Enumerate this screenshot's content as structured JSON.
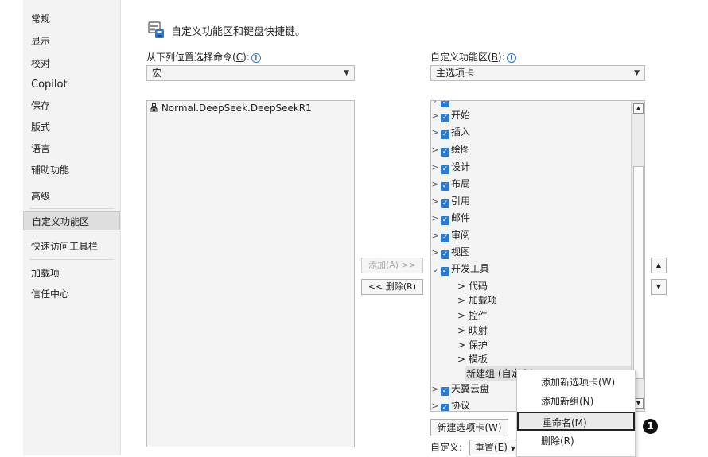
{
  "sidebar": {
    "items": [
      {
        "label": "常规"
      },
      {
        "label": "显示"
      },
      {
        "label": "校对"
      },
      {
        "label": "Copilot"
      },
      {
        "label": "保存"
      },
      {
        "label": "版式"
      },
      {
        "label": "语言"
      },
      {
        "label": "辅助功能"
      },
      {
        "label": "高级"
      },
      {
        "label": "自定义功能区",
        "selected": true
      },
      {
        "label": "快速访问工具栏"
      },
      {
        "label": "加载项"
      },
      {
        "label": "信任中心"
      }
    ]
  },
  "header": {
    "title": "自定义功能区和键盘快捷键。"
  },
  "left": {
    "label_prefix": "从下列位置选择命令(",
    "label_key": "C",
    "label_suffix": "):",
    "dropdown_value": "宏",
    "commands": [
      "Normal.DeepSeek.DeepSeekR1"
    ]
  },
  "middle": {
    "add_label": "添加(A) >>",
    "remove_label": "<< 删除(R)"
  },
  "right": {
    "label_prefix": "自定义功能区(",
    "label_key": "B",
    "label_suffix": "):",
    "dropdown_value": "主选项卡",
    "tabs": [
      {
        "label": "开始"
      },
      {
        "label": "插入"
      },
      {
        "label": "绘图"
      },
      {
        "label": "设计"
      },
      {
        "label": "布局"
      },
      {
        "label": "引用"
      },
      {
        "label": "邮件"
      },
      {
        "label": "审阅"
      },
      {
        "label": "视图"
      },
      {
        "label": "开发工具",
        "expanded": true,
        "groups": [
          "代码",
          "加载项",
          "控件",
          "映射",
          "保护",
          "模板"
        ],
        "new_group": "新建组 (自定义)"
      },
      {
        "label": "天翼云盘"
      },
      {
        "label": "协议"
      }
    ],
    "new_tab_button": "新建选项卡(W)",
    "customize_label": "自定义:",
    "reset_button": "重置(E)"
  },
  "context_menu": {
    "items": [
      {
        "label": "添加新选项卡(W)"
      },
      {
        "label": "添加新组(N)"
      },
      {
        "label": "重命名(M)",
        "highlighted": true
      },
      {
        "label": "删除(R)"
      }
    ]
  },
  "annotation": {
    "number": "1"
  },
  "colors": {
    "checkbox": "#2b79d0",
    "selected_nav": "#dedede",
    "badge": "#111111"
  }
}
